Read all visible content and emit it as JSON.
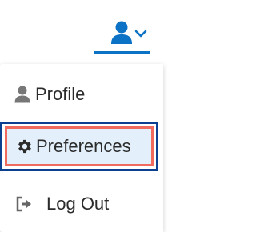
{
  "header": {
    "user_menu": {
      "avatar_icon": "user-icon",
      "chevron_icon": "chevron-down-icon",
      "accent": "#0b72c5"
    }
  },
  "menu": {
    "items": [
      {
        "label": "Profile",
        "icon": "user-icon"
      },
      {
        "label": "Preferences",
        "icon": "gear-icon",
        "highlighted": true
      },
      {
        "label": "Log Out",
        "icon": "sign-out-icon"
      }
    ]
  },
  "colors": {
    "accent": "#0b72c5",
    "focus_outer": "#0b3f8f",
    "focus_inner": "#ef6b5d",
    "selected_bg": "#e3f0fb",
    "text": "#2b2b2b",
    "icon_gray": "#777777"
  }
}
